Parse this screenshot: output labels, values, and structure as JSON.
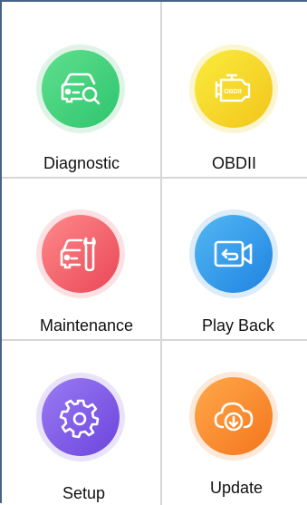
{
  "menu": {
    "items": [
      {
        "label": "Diagnostic",
        "icon": "car-search-icon",
        "color": "#2fc46e"
      },
      {
        "label": "OBDII",
        "icon": "engine-obdii-icon",
        "color": "#f3c51c"
      },
      {
        "label": "Maintenance",
        "icon": "car-wrench-icon",
        "color": "#e94657"
      },
      {
        "label": "Play Back",
        "icon": "video-replay-icon",
        "color": "#1f84e0"
      },
      {
        "label": "Setup",
        "icon": "gear-icon",
        "color": "#6c44dd"
      },
      {
        "label": "Update",
        "icon": "cloud-download-icon",
        "color": "#f4751d"
      }
    ],
    "engine_badge": "OBDII"
  }
}
